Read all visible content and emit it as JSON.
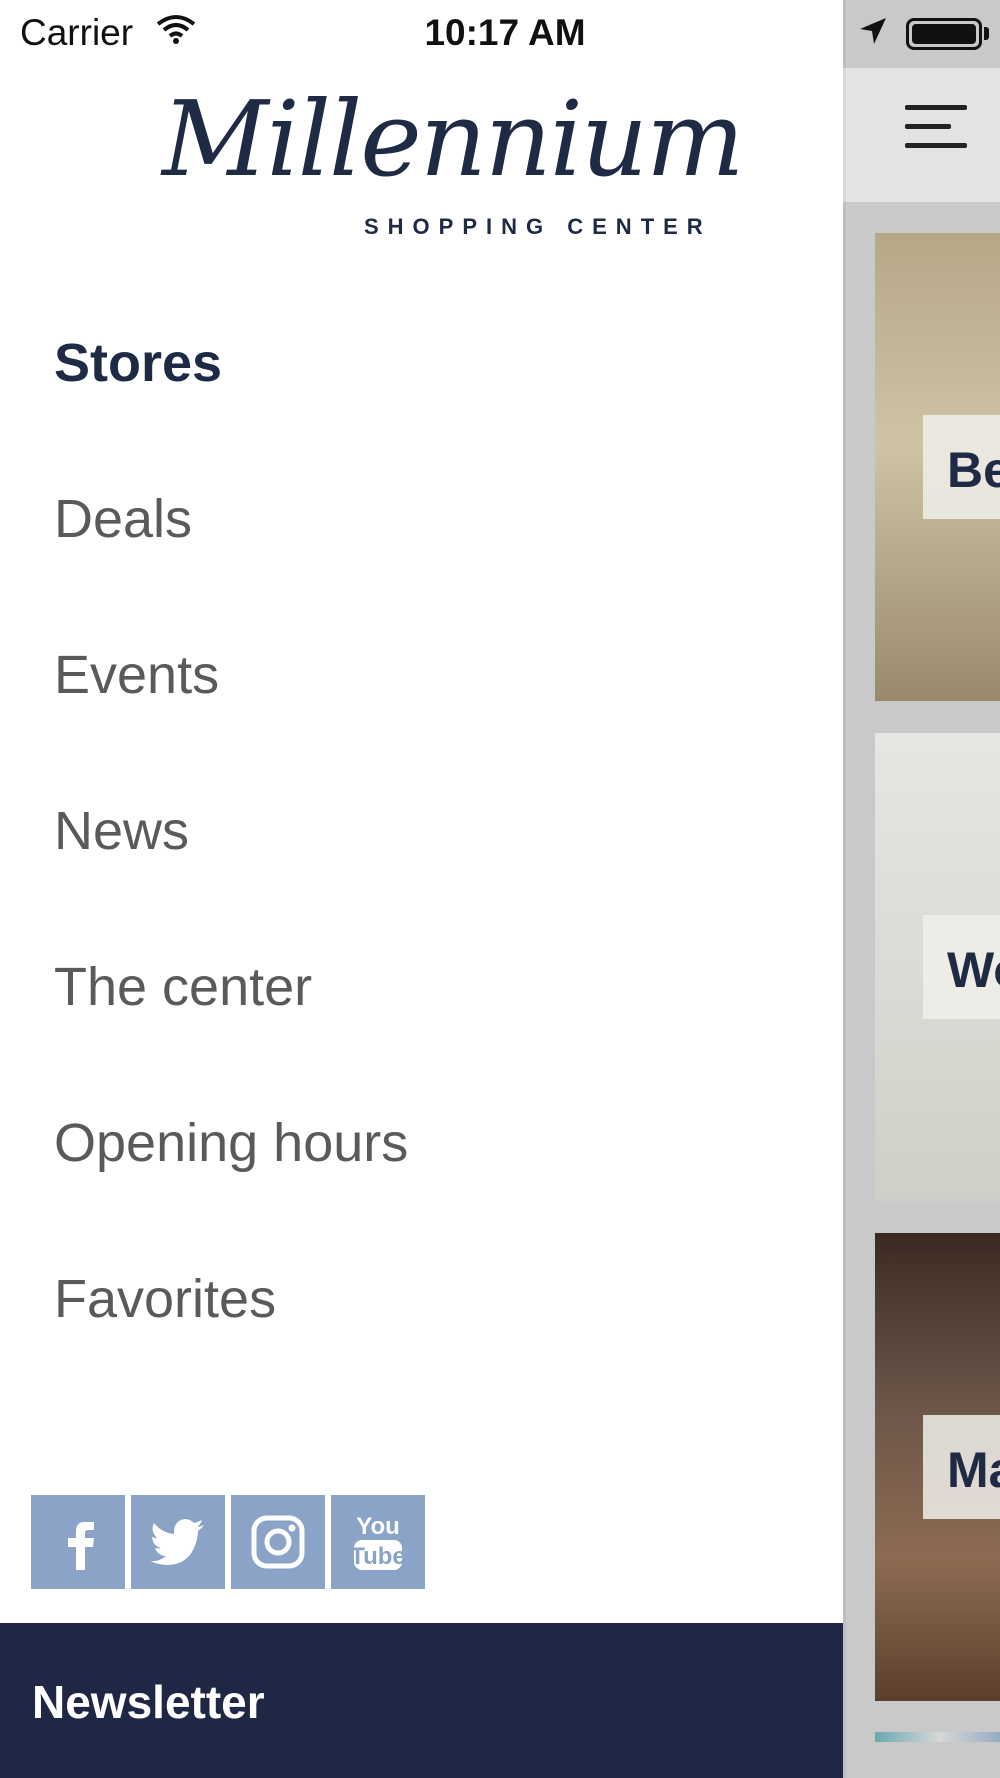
{
  "status_bar": {
    "carrier": "Carrier",
    "time": "10:17 AM"
  },
  "drawer": {
    "logo": {
      "script_text": "Millennium",
      "subtitle": "SHOPPING CENTER"
    },
    "menu_items": [
      {
        "label": "Stores",
        "active": true
      },
      {
        "label": "Deals",
        "active": false
      },
      {
        "label": "Events",
        "active": false
      },
      {
        "label": "News",
        "active": false
      },
      {
        "label": "The center",
        "active": false
      },
      {
        "label": "Opening hours",
        "active": false
      },
      {
        "label": "Favorites",
        "active": false
      }
    ],
    "social": [
      {
        "name": "facebook-icon",
        "glyph": "f"
      },
      {
        "name": "twitter-icon",
        "glyph": "bird"
      },
      {
        "name": "instagram-icon",
        "glyph": "camera"
      },
      {
        "name": "youtube-icon",
        "glyph_top": "You",
        "glyph_bottom": "Tube"
      }
    ],
    "newsletter_label": "Newsletter"
  },
  "main": {
    "cards": [
      {
        "label": "Be"
      },
      {
        "label": "Wo"
      },
      {
        "label": "Ma"
      }
    ]
  },
  "colors": {
    "brand_navy": "#1f2744",
    "menu_active": "#1f2a44",
    "menu_inactive": "#5a5a5a",
    "social_tile": "#8ba3c7"
  }
}
